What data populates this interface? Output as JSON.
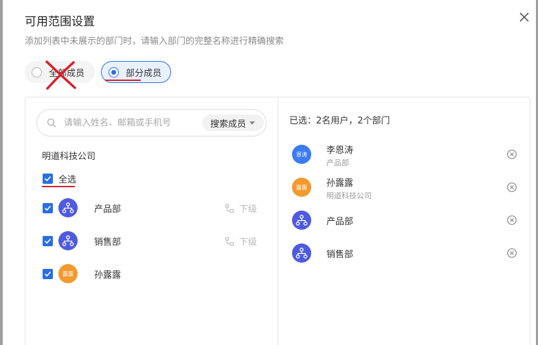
{
  "dialog": {
    "title": "可用范围设置",
    "subtitle": "添加列表中未展示的部门时，请输入部门的完整名称进行精确搜索"
  },
  "scope_options": [
    {
      "label": "全部成员",
      "selected": false
    },
    {
      "label": "部分成员",
      "selected": true
    }
  ],
  "search": {
    "placeholder": "请输入姓名、邮箱或手机号",
    "scope_label": "搜索成员"
  },
  "tree": {
    "company": "明道科技公司",
    "select_all": "全选",
    "items": [
      {
        "label": "产品部",
        "type": "department",
        "checked": true,
        "sublevel": "下级"
      },
      {
        "label": "销售部",
        "type": "department",
        "checked": true,
        "sublevel": "下级"
      },
      {
        "label": "孙露露",
        "type": "user",
        "avatar_text": "露露",
        "checked": true
      }
    ]
  },
  "selected": {
    "summary": "已选：2名用户，2个部门",
    "items": [
      {
        "name": "李恩涛",
        "sub": "产品部",
        "avatar_text": "恩涛",
        "type": "user"
      },
      {
        "name": "孙露露",
        "sub": "明道科技公司",
        "avatar_text": "露露",
        "type": "user"
      },
      {
        "name": "产品部",
        "type": "department"
      },
      {
        "name": "销售部",
        "type": "department"
      }
    ]
  },
  "colors": {
    "accent": "#2a6fe0",
    "annotation_red": "#d8202a",
    "dept_avatar": "#4e5bde",
    "orange_avatar": "#f29a2e",
    "blue_avatar": "#3b7cf0"
  }
}
